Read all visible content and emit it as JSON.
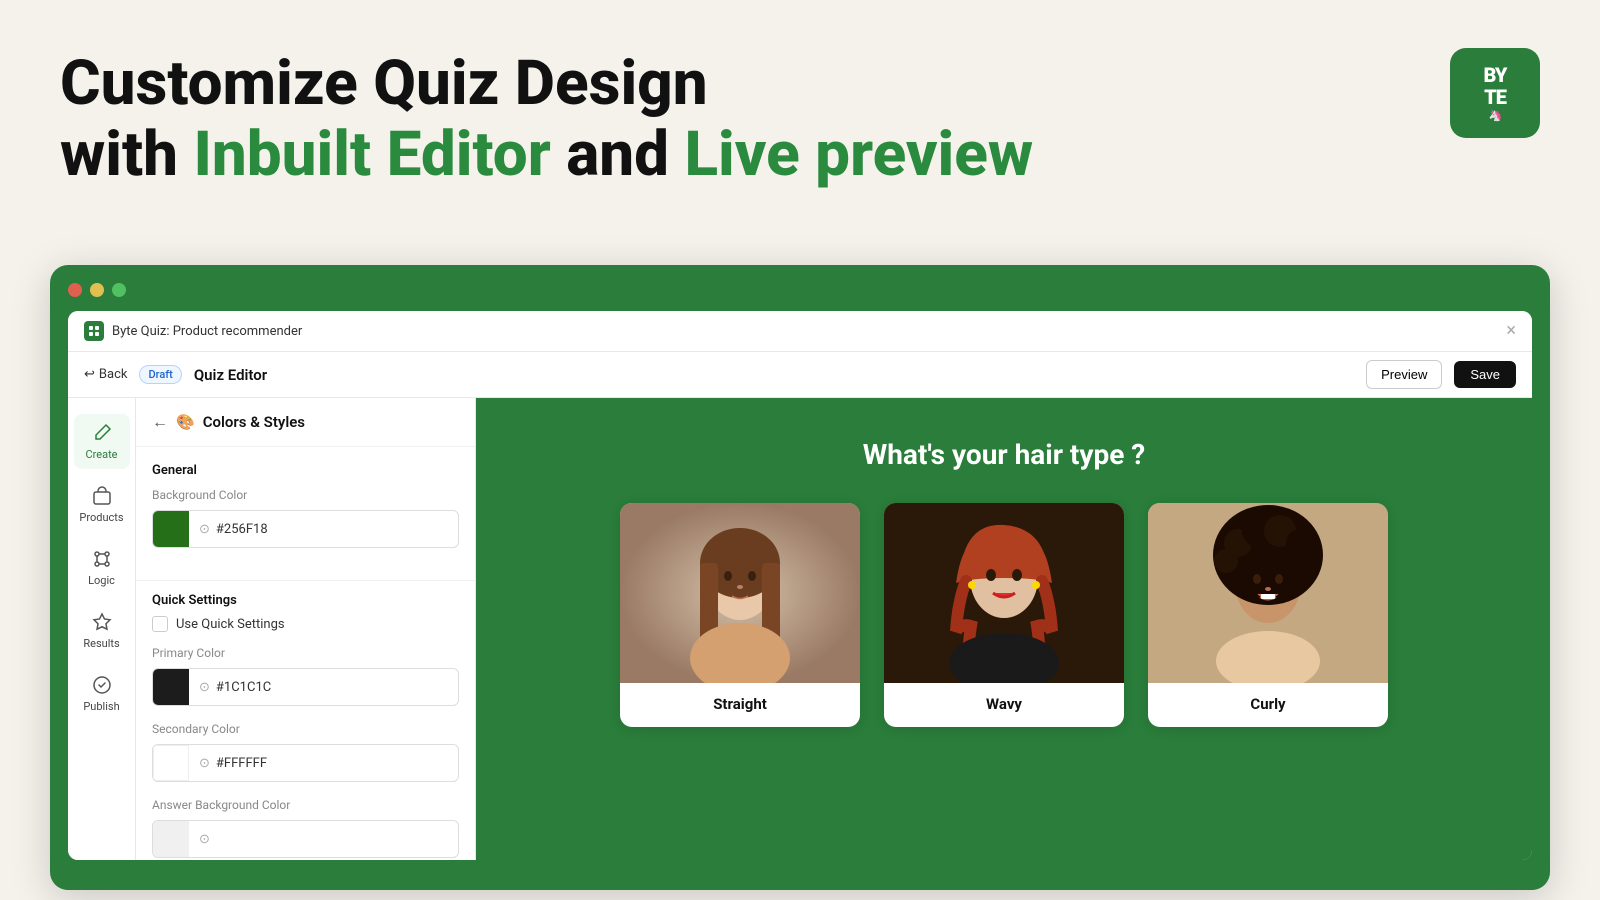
{
  "page": {
    "background_color": "#f5f2ec"
  },
  "hero": {
    "line1": "Customize Quiz Design",
    "line2_start": "with ",
    "line2_green1": "Inbuilt Editor",
    "line2_mid": " and ",
    "line2_green2": "Live preview"
  },
  "brand": {
    "logo_line1": "BY",
    "logo_line2": "TE"
  },
  "window": {
    "title": "Byte Quiz: Product recommender",
    "close_char": "×",
    "dots": [
      "red",
      "yellow",
      "green"
    ]
  },
  "toolbar": {
    "back_label": "Back",
    "draft_label": "Draft",
    "editor_title": "Quiz Editor",
    "preview_label": "Preview",
    "save_label": "Save"
  },
  "sidebar": {
    "items": [
      {
        "id": "create",
        "label": "Create",
        "icon": "✏️",
        "active": true
      },
      {
        "id": "products",
        "label": "Products",
        "icon": "🏷️",
        "active": false
      },
      {
        "id": "logic",
        "label": "Logic",
        "icon": "⚙️",
        "active": false
      },
      {
        "id": "results",
        "label": "Results",
        "icon": "📊",
        "active": false
      },
      {
        "id": "publish",
        "label": "Publish",
        "icon": "✅",
        "active": false
      }
    ]
  },
  "editor": {
    "panel_title": "Colors & Styles",
    "general_label": "General",
    "background_color_label": "Background Color",
    "background_color_value": "#256F18",
    "quick_settings_label": "Quick Settings",
    "use_quick_settings_label": "Use Quick Settings",
    "primary_color_label": "Primary Color",
    "primary_color_value": "#1C1C1C",
    "secondary_color_label": "Secondary Color",
    "secondary_color_value": "#FFFFFF",
    "answer_bg_color_label": "Answer Background Color"
  },
  "preview": {
    "question": "What's your hair type ?",
    "options": [
      {
        "id": "straight",
        "label": "Straight"
      },
      {
        "id": "wavy",
        "label": "Wavy"
      },
      {
        "id": "curly",
        "label": "Curly"
      }
    ]
  }
}
